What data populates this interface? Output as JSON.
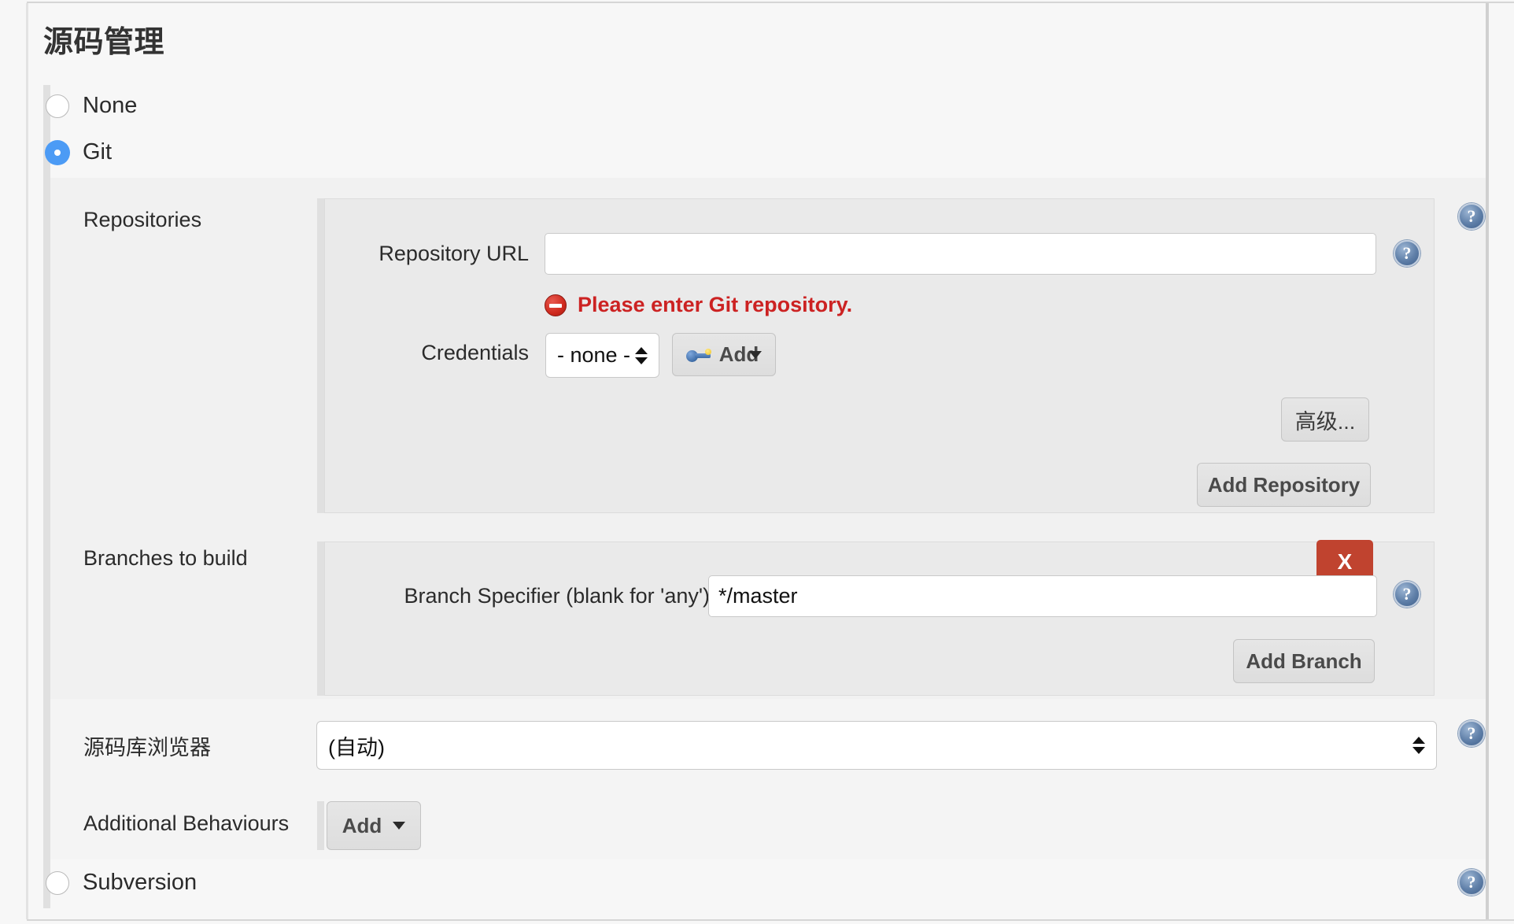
{
  "page": {
    "title": "源码管理"
  },
  "scm_options": [
    {
      "label": "None",
      "selected": false
    },
    {
      "label": "Git",
      "selected": true
    },
    {
      "label": "Subversion",
      "selected": false
    }
  ],
  "git": {
    "repositories": {
      "label": "Repositories",
      "repository_url": {
        "label": "Repository URL",
        "value": "",
        "error": "Please enter Git repository.",
        "error_icon": "error-circle-icon"
      },
      "credentials": {
        "label": "Credentials",
        "selected": "- none -",
        "add_button": "Add",
        "add_button_icon": "key-icon",
        "add_button_caret": "caret-down-icon"
      },
      "advanced_button": "高级...",
      "add_repository_button": "Add Repository"
    },
    "branches": {
      "label": "Branches to build",
      "delete_button": "X",
      "branch_specifier": {
        "label": "Branch Specifier (blank for 'any')",
        "value": "*/master"
      },
      "add_branch_button": "Add Branch"
    },
    "scm_browser": {
      "label": "源码库浏览器",
      "selected": "(自动)"
    },
    "additional_behaviours": {
      "label": "Additional Behaviours",
      "add_button": "Add",
      "add_button_caret": "caret-down-icon"
    }
  },
  "help": {
    "glyph": "?",
    "icon_name": "help-icon"
  },
  "colors": {
    "accent_blue": "#4c9bf5",
    "error_red": "#cc2222",
    "delete_red": "#c0432f",
    "help_blue": "#5f7fa8",
    "panel_bg": "#eaeaea",
    "band_bg": "#f1f1f1",
    "page_bg": "#f7f7f7"
  }
}
